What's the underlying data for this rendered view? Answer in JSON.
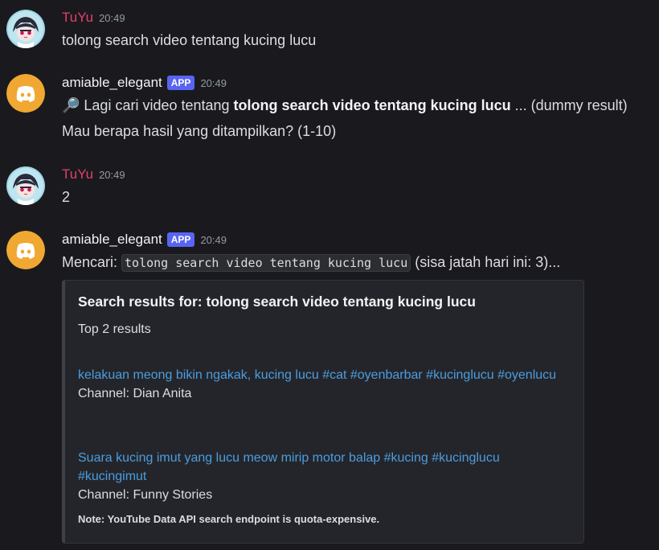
{
  "messages": [
    {
      "username": "TuYu",
      "time": "20:49",
      "text": "tolong search video tentang kucing lucu"
    },
    {
      "username": "amiable_elegant",
      "badge": "APP",
      "time": "20:49",
      "line1_prefix": "🔎 Lagi cari video tentang ",
      "line1_bold": "tolong search video tentang kucing lucu",
      "line1_suffix": " ... (dummy result)",
      "line2": "Mau berapa hasil yang ditampilkan? (1-10)"
    },
    {
      "username": "TuYu",
      "time": "20:49",
      "text": "2"
    },
    {
      "username": "amiable_elegant",
      "badge": "APP",
      "time": "20:49",
      "line_prefix": "Mencari: ",
      "line_code": "tolong search video tentang kucing lucu",
      "line_suffix": " (sisa jatah hari ini: 3)..."
    }
  ],
  "embed": {
    "title": "Search results for: tolong search video tentang kucing lucu",
    "subtitle": "Top 2 results",
    "results": [
      {
        "title": "kelakuan meong bikin ngakak, kucing lucu #cat #oyenbarbar #kucinglucu #oyenlucu",
        "channel": "Channel: Dian Anita"
      },
      {
        "title": "Suara kucing imut yang lucu meow mirip motor balap #kucing #kucinglucu #kucingimut",
        "channel": "Channel: Funny Stories"
      }
    ],
    "note": "Note: YouTube Data API search endpoint is quota-expensive."
  },
  "colors": {
    "background": "#1a1a1e",
    "user_name": "#e0406a",
    "bot_avatar": "#f0a832",
    "badge": "#5865f2",
    "link": "#4b9ddf"
  },
  "icons": {
    "bot_avatar": "discord-logo-icon",
    "user_avatar": "anime-avatar-icon",
    "search": "magnifier-icon"
  }
}
